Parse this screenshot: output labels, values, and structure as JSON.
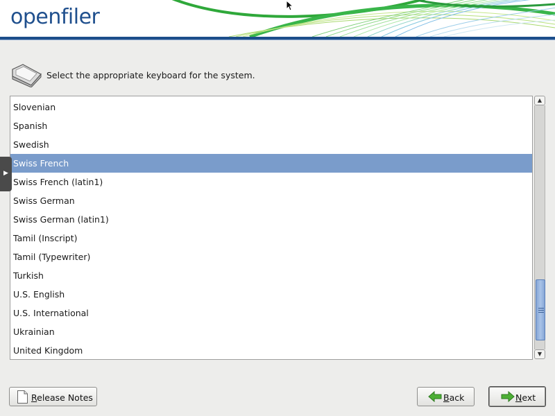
{
  "header": {
    "brand": "openfiler"
  },
  "prompt": {
    "text": "Select the appropriate keyboard for the system."
  },
  "keyboard_list": {
    "items": [
      "Slovenian",
      "Spanish",
      "Swedish",
      "Swiss French",
      "Swiss French (latin1)",
      "Swiss German",
      "Swiss German (latin1)",
      "Tamil (Inscript)",
      "Tamil (Typewriter)",
      "Turkish",
      "U.S. English",
      "U.S. International",
      "Ukrainian",
      "United Kingdom"
    ],
    "selected_index": 3,
    "selected_value": "Swiss French",
    "scroll_position": 0.95
  },
  "buttons": {
    "release_notes": {
      "mnemonic": "R",
      "rest": "elease Notes"
    },
    "back": {
      "mnemonic": "B",
      "rest": "ack"
    },
    "next": {
      "mnemonic": "N",
      "rest": "ext"
    }
  },
  "icons": {
    "keyboard": "keyboard-key-icon",
    "release_notes": "document-icon",
    "back": "green-left-arrow-icon",
    "next": "green-right-arrow-icon",
    "side_tab": "chevron-right-icon"
  },
  "colors": {
    "brand": "#1f4f8d",
    "selection": "#7a9ccb",
    "arrow_green": "#3fa22a"
  }
}
